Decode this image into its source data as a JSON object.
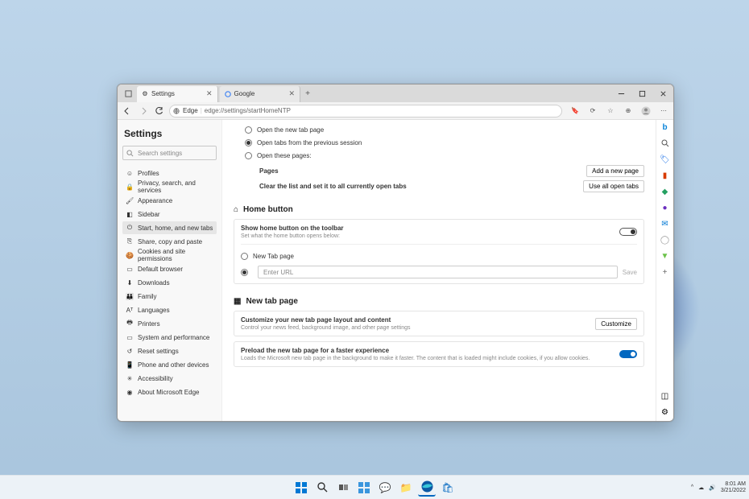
{
  "desktop": {
    "time": "8:01 AM",
    "date": "3/21/2022"
  },
  "tabs": [
    {
      "label": "Settings",
      "active": true
    },
    {
      "label": "Google",
      "active": false
    }
  ],
  "url": {
    "prefix": "Edge",
    "path": "edge://settings/startHomeNTP"
  },
  "settings_title": "Settings",
  "search": {
    "placeholder": "Search settings"
  },
  "sidebar": {
    "items": [
      {
        "label": "Profiles"
      },
      {
        "label": "Privacy, search, and services"
      },
      {
        "label": "Appearance"
      },
      {
        "label": "Sidebar"
      },
      {
        "label": "Start, home, and new tabs"
      },
      {
        "label": "Share, copy and paste"
      },
      {
        "label": "Cookies and site permissions"
      },
      {
        "label": "Default browser"
      },
      {
        "label": "Downloads"
      },
      {
        "label": "Family"
      },
      {
        "label": "Languages"
      },
      {
        "label": "Printers"
      },
      {
        "label": "System and performance"
      },
      {
        "label": "Reset settings"
      },
      {
        "label": "Phone and other devices"
      },
      {
        "label": "Accessibility"
      },
      {
        "label": "About Microsoft Edge"
      }
    ]
  },
  "startup": {
    "opt1": "Open the new tab page",
    "opt2": "Open tabs from the previous session",
    "opt3": "Open these pages:",
    "pages_label": "Pages",
    "add_btn": "Add a new page",
    "clear_label": "Clear the list and set it to all currently open tabs",
    "use_btn": "Use all open tabs"
  },
  "home": {
    "title": "Home button",
    "show_title": "Show home button on the toolbar",
    "show_desc": "Set what the home button opens below:",
    "opt_ntp": "New Tab page",
    "url_placeholder": "Enter URL",
    "save": "Save"
  },
  "ntp": {
    "title": "New tab page",
    "customize_title": "Customize your new tab page layout and content",
    "customize_desc": "Control your news feed, background image, and other page settings",
    "customize_btn": "Customize",
    "preload_title": "Preload the new tab page for a faster experience",
    "preload_desc": "Loads the Microsoft new tab page in the background to make it faster. The content that is loaded might include cookies, if you allow cookies."
  }
}
